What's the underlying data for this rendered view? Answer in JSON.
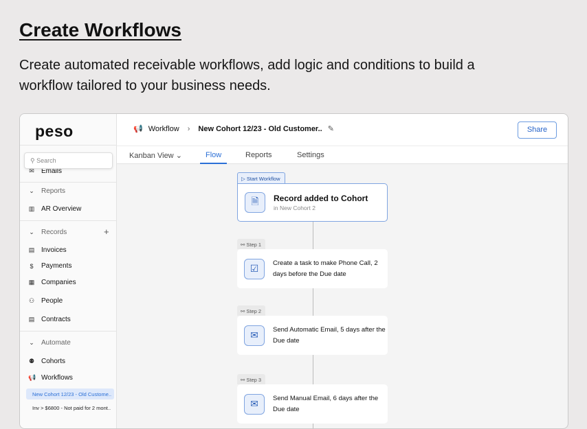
{
  "hero": {
    "title": "Create Workflows",
    "subtitle": "Create automated receivable workflows, add logic and conditions to build a workflow tailored to your business needs."
  },
  "sidebar": {
    "logo": "peso",
    "search_placeholder": "Search",
    "emails": "Emails",
    "reports": "Reports",
    "ar_overview": "AR Overview",
    "records": "Records",
    "add": "+",
    "invoices": "Invoices",
    "payments": "Payments",
    "companies": "Companies",
    "people": "People",
    "contracts": "Contracts",
    "automate": "Automate",
    "cohorts": "Cohorts",
    "workflows": "Workflows",
    "wf1": "New Cohort 12/23 - Old Custome..",
    "wf2": "Inv > $6800 - Not paid for 2 mont.."
  },
  "header": {
    "crumb_root": "Workflow",
    "sep": "›",
    "crumb_current": "New Cohort 12/23 - Old Customer..",
    "share": "Share"
  },
  "tabs": {
    "kanban": "Kanban View",
    "flow": "Flow",
    "reports": "Reports",
    "settings": "Settings"
  },
  "flow": {
    "start_label": "Start Workflow",
    "start_title": "Record added to Cohort",
    "start_sub": "in New Cohort 2",
    "steps": [
      {
        "label": "Step 1",
        "text": "Create a task to make Phone Call, 2 days before the Due date"
      },
      {
        "label": "Step 2",
        "text": "Send Automatic Email, 5 days after the Due date"
      },
      {
        "label": "Step 3",
        "text": "Send Manual Email, 6 days after the Due date"
      }
    ]
  }
}
